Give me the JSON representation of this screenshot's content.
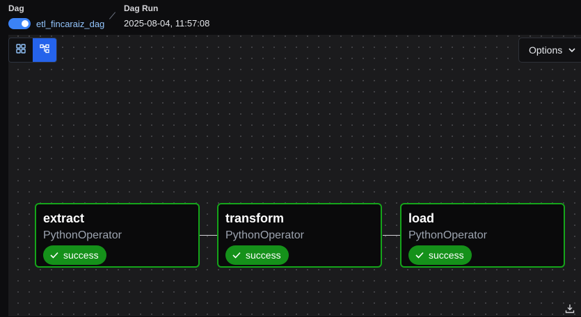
{
  "header": {
    "dag_label": "Dag",
    "dag_name": "etl_fincaraiz_dag",
    "dag_enabled": true,
    "run_label": "Dag Run",
    "run_value": "2025-08-04, 11:57:08"
  },
  "view_toggle": {
    "grid_icon": "grid-icon",
    "graph_icon": "graph-icon",
    "active": "graph"
  },
  "options": {
    "label": "Options"
  },
  "nodes": [
    {
      "name": "extract",
      "operator": "PythonOperator",
      "status": "success"
    },
    {
      "name": "transform",
      "operator": "PythonOperator",
      "status": "success"
    },
    {
      "name": "load",
      "operator": "PythonOperator",
      "status": "success"
    }
  ],
  "colors": {
    "accent": "#3b82f6",
    "success_border": "#15a51a",
    "success_badge": "#15911a",
    "canvas_bg": "#1b1b1d"
  }
}
